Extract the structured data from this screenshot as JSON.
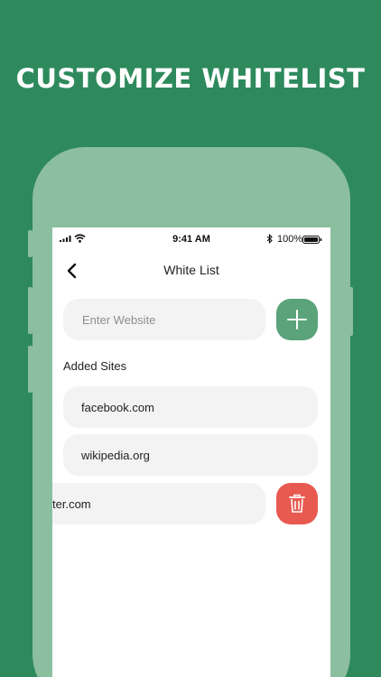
{
  "headline": "CUSTOMIZE WHITELIST",
  "status_bar": {
    "time": "9:41 AM",
    "battery_percent": "100%",
    "icons": [
      "signal-icon",
      "wifi-icon",
      "bluetooth-icon",
      "battery-icon"
    ]
  },
  "nav": {
    "back_icon": "chevron-left-icon",
    "title": "White List"
  },
  "input": {
    "placeholder": "Enter Website",
    "value": ""
  },
  "add_button": {
    "icon": "plus-icon"
  },
  "section": {
    "label": "Added Sites"
  },
  "sites": [
    {
      "url": "facebook.com"
    },
    {
      "url": "wikipedia.org"
    },
    {
      "url": "twitter.com",
      "visible_text": "ter.com",
      "swiped": true
    }
  ],
  "delete_button": {
    "icon": "trash-icon"
  },
  "colors": {
    "background": "#2e8a5c",
    "phone_frame": "#8cbf9f",
    "add_button": "#5aa37b",
    "delete_button": "#e85a50",
    "field_bg": "#f3f3f3"
  }
}
